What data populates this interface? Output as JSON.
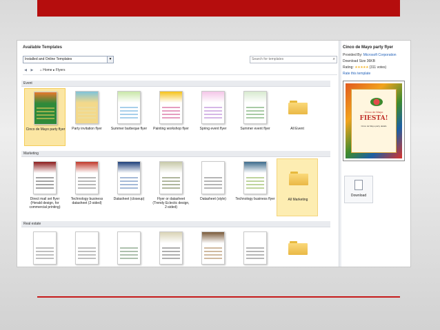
{
  "dialog": {
    "title": "Available Templates",
    "source_select": "Installed and Online Templates",
    "search_placeholder": "Search for templates",
    "breadcrumb": {
      "home": "Home",
      "current": "Flyers"
    }
  },
  "sections": [
    {
      "name": "Event",
      "items": [
        {
          "label": "Cinco de Mayo party flyer",
          "kind": "template",
          "selected": true,
          "palette": [
            "#e8782a",
            "#2f8a3a",
            "#f5d25c"
          ]
        },
        {
          "label": "Party invitation flyer",
          "kind": "template",
          "palette": [
            "#7fc3d9",
            "#f3d98b",
            "#e6e0b0"
          ]
        },
        {
          "label": "Summer barbeque flyer",
          "kind": "template",
          "palette": [
            "#c9e7a8",
            "#ffffff",
            "#5fa8d8"
          ]
        },
        {
          "label": "Painting workshop flyer",
          "kind": "template",
          "palette": [
            "#f5c21b",
            "#ffffff",
            "#d04b8a"
          ]
        },
        {
          "label": "Spring event flyer",
          "kind": "template",
          "palette": [
            "#f4c6e8",
            "#ffffff",
            "#b37ad1"
          ]
        },
        {
          "label": "Summer event flyer",
          "kind": "template",
          "palette": [
            "#d8ead0",
            "#ffffff",
            "#5e9e5a"
          ]
        },
        {
          "label": "All Event",
          "kind": "folder"
        }
      ]
    },
    {
      "name": "Marketing",
      "items": [
        {
          "label": "Direct mail set flyer (Herald design, for commercial printing)",
          "kind": "template",
          "palette": [
            "#8c1c1c",
            "#ffffff",
            "#555555"
          ]
        },
        {
          "label": "Technology business datasheet (2-sided)",
          "kind": "template",
          "palette": [
            "#c0392b",
            "#ffffff",
            "#7a7a7a"
          ]
        },
        {
          "label": "Datasheet (closeup)",
          "kind": "template",
          "palette": [
            "#1d3f7a",
            "#ffffff",
            "#5a7fb7"
          ]
        },
        {
          "label": "Flyer or datasheet (Trendy Eclectic design, 2-sided)",
          "kind": "template",
          "palette": [
            "#c7c9a8",
            "#ffffff",
            "#6e7a4a"
          ]
        },
        {
          "label": "Datasheet (style)",
          "kind": "template",
          "palette": [
            "#ffffff",
            "#ffffff",
            "#777777"
          ]
        },
        {
          "label": "Technology business flyer",
          "kind": "template",
          "palette": [
            "#3d6b8c",
            "#ffffff",
            "#88b04b"
          ]
        },
        {
          "label": "All Marketing",
          "kind": "folder",
          "selected": true
        }
      ]
    },
    {
      "name": "Real estate",
      "items": [
        {
          "label": "",
          "kind": "template",
          "palette": [
            "#ffffff",
            "#ffffff",
            "#888888"
          ]
        },
        {
          "label": "",
          "kind": "template",
          "palette": [
            "#ffffff",
            "#ffffff",
            "#888888"
          ]
        },
        {
          "label": "",
          "kind": "template",
          "palette": [
            "#ffffff",
            "#ffffff",
            "#6a8c6a"
          ]
        },
        {
          "label": "",
          "kind": "template",
          "palette": [
            "#d9d3b5",
            "#ffffff",
            "#6b6b6b"
          ]
        },
        {
          "label": "",
          "kind": "template",
          "palette": [
            "#7a5a3a",
            "#ffffff",
            "#a88050"
          ]
        },
        {
          "label": "",
          "kind": "template",
          "palette": [
            "#ffffff",
            "#ffffff",
            "#7a7a7a"
          ]
        },
        {
          "label": "",
          "kind": "folder"
        }
      ]
    }
  ],
  "details": {
    "title": "Cinco de Mayo party flyer",
    "provided_by_label": "Provided By:",
    "provided_by": "Microsoft Corporation",
    "download_size": "Download Size 36KB",
    "rating_label": "Rating:",
    "rating_stars": "★★★★★",
    "votes": "(311 votes)",
    "rate_link": "Rate this template",
    "preview": {
      "line1": "Cinco de Mayo",
      "line2": "FIESTA!",
      "line3": "Cinco de Mayo party details"
    },
    "download_label": "Download"
  },
  "colors": {
    "banner": "#b50d0d",
    "rule": "#c51a1a",
    "accent_link": "#1f5fb8"
  }
}
